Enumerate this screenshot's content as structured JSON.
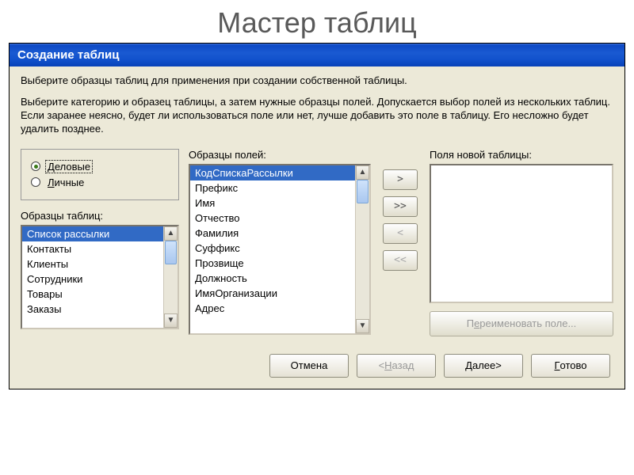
{
  "slide": {
    "title": "Мастер таблиц"
  },
  "dialog": {
    "title": "Создание таблиц",
    "intro1": "Выберите образцы таблиц для применения при создании собственной таблицы.",
    "intro2": "Выберите категорию и образец таблицы, а затем нужные образцы полей. Допускается выбор полей из нескольких таблиц. Если заранее неясно, будет ли использоваться поле или нет, лучше добавить это поле в таблицу. Его несложно будет удалить позднее."
  },
  "category": {
    "options": [
      {
        "label": "Деловые",
        "checked": true,
        "accessKey": "Д"
      },
      {
        "label": "Личные",
        "checked": false,
        "accessKey": "Л"
      }
    ]
  },
  "tablesLabel": "Образцы таблиц:",
  "tables": [
    "Список рассылки",
    "Контакты",
    "Клиенты",
    "Сотрудники",
    "Товары",
    "Заказы"
  ],
  "tablesSelectedIndex": 0,
  "fieldsLabel": "Образцы полей:",
  "fields": [
    "КодСпискаРассылки",
    "Префикс",
    "Имя",
    "Отчество",
    "Фамилия",
    "Суффикс",
    "Прозвище",
    "Должность",
    "ИмяОрганизации",
    "Адрес"
  ],
  "fieldsSelectedIndex": 0,
  "newFieldsLabel": "Поля новой таблицы:",
  "moveButtons": {
    "add": ">",
    "addAll": ">>",
    "remove": "<",
    "removeAll": "<<"
  },
  "renameButton": "Переименовать поле...",
  "bottom": {
    "cancel": "Отмена",
    "back": "< Назад",
    "next": "Далее >",
    "finish": "Готово"
  }
}
